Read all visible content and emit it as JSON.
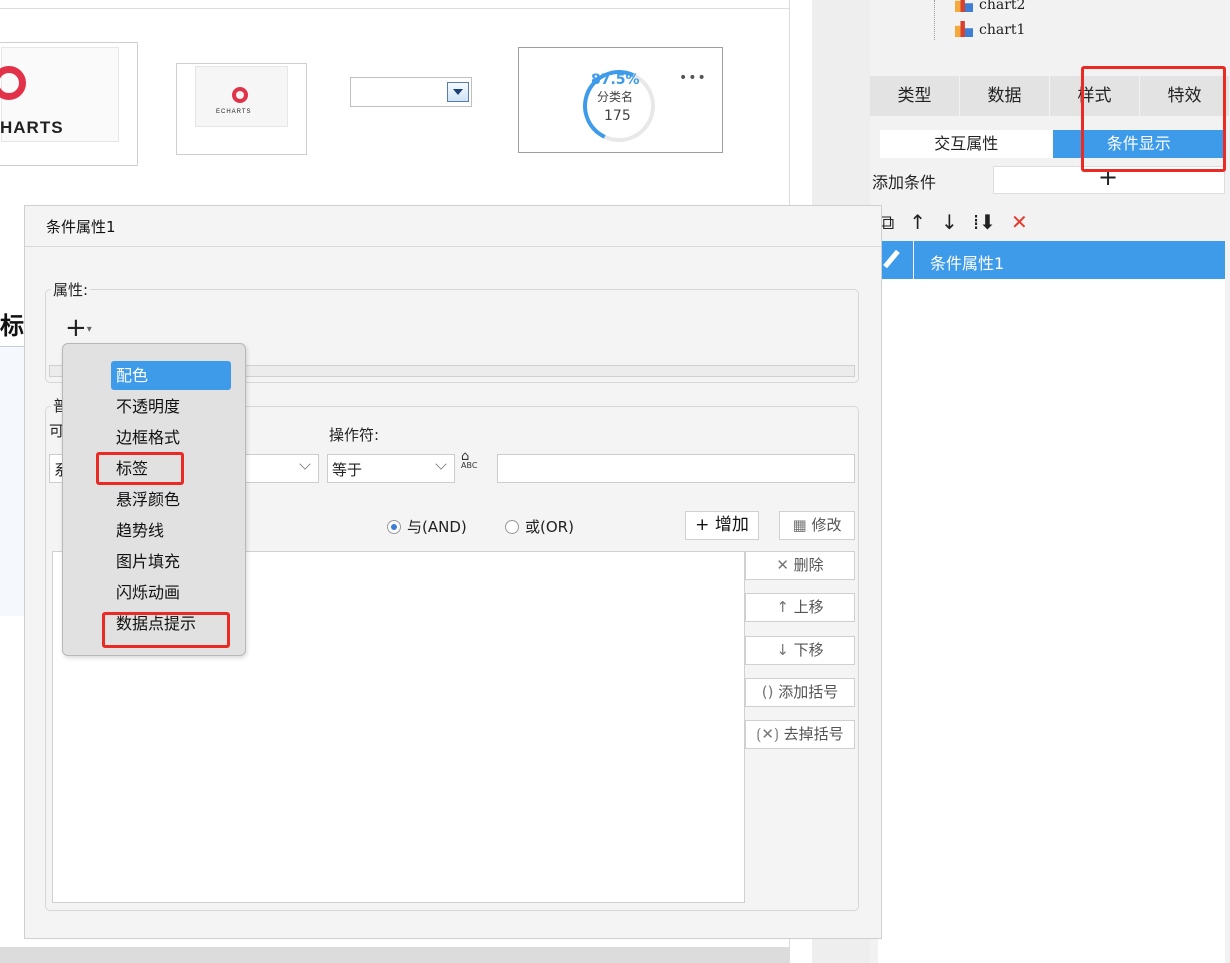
{
  "canvas": {
    "gauge": {
      "percent": "87.5%",
      "category": "分类名",
      "value": "175",
      "more": "•••"
    },
    "echarts_word": "HARTS",
    "echarts_word_small": "ECHARTS",
    "bg_char": "标"
  },
  "right_panel": {
    "tree": [
      {
        "label": "chart2"
      },
      {
        "label": "chart1"
      }
    ],
    "main_tabs": [
      {
        "label": "类型"
      },
      {
        "label": "数据"
      },
      {
        "label": "样式"
      },
      {
        "label": "特效"
      }
    ],
    "sub_tabs": [
      {
        "label": "交互属性"
      },
      {
        "label": "条件显示"
      }
    ],
    "add_condition_label": "添加条件",
    "add_condition_plus": "+",
    "toolbar_icons": [
      "copy-icon",
      "arrow-up-icon",
      "arrow-down-icon",
      "sort-icon",
      "delete-icon"
    ],
    "condition_list": [
      {
        "label": "条件属性1"
      }
    ]
  },
  "dialog": {
    "title": "条件属性1",
    "property_legend": "属性:",
    "add_property_plus": "+",
    "condition_legend_partial": "普",
    "variable_label_partial": "可",
    "variable_value_partial": "系",
    "operator_label": "操作符:",
    "operator_value": "等于",
    "formula_icon_label": "ABC",
    "radio_and": "与(AND)",
    "radio_or": "或(OR)",
    "buttons": {
      "add": "增加",
      "modify": "修改",
      "delete": "删除",
      "move_up": "上移",
      "move_down": "下移",
      "add_bracket": "添加括号",
      "remove_bracket": "去掉括号"
    }
  },
  "popup_menu": {
    "items": [
      {
        "label": "配色",
        "active": true
      },
      {
        "label": "不透明度"
      },
      {
        "label": "边框格式"
      },
      {
        "label": "标签"
      },
      {
        "label": "悬浮颜色"
      },
      {
        "label": "趋势线"
      },
      {
        "label": "图片填充"
      },
      {
        "label": "闪烁动画"
      },
      {
        "label": "数据点提示"
      }
    ]
  },
  "colors": {
    "accent": "#3d9be9",
    "highlight": "#ec2a24",
    "delete": "#e53a2e"
  }
}
